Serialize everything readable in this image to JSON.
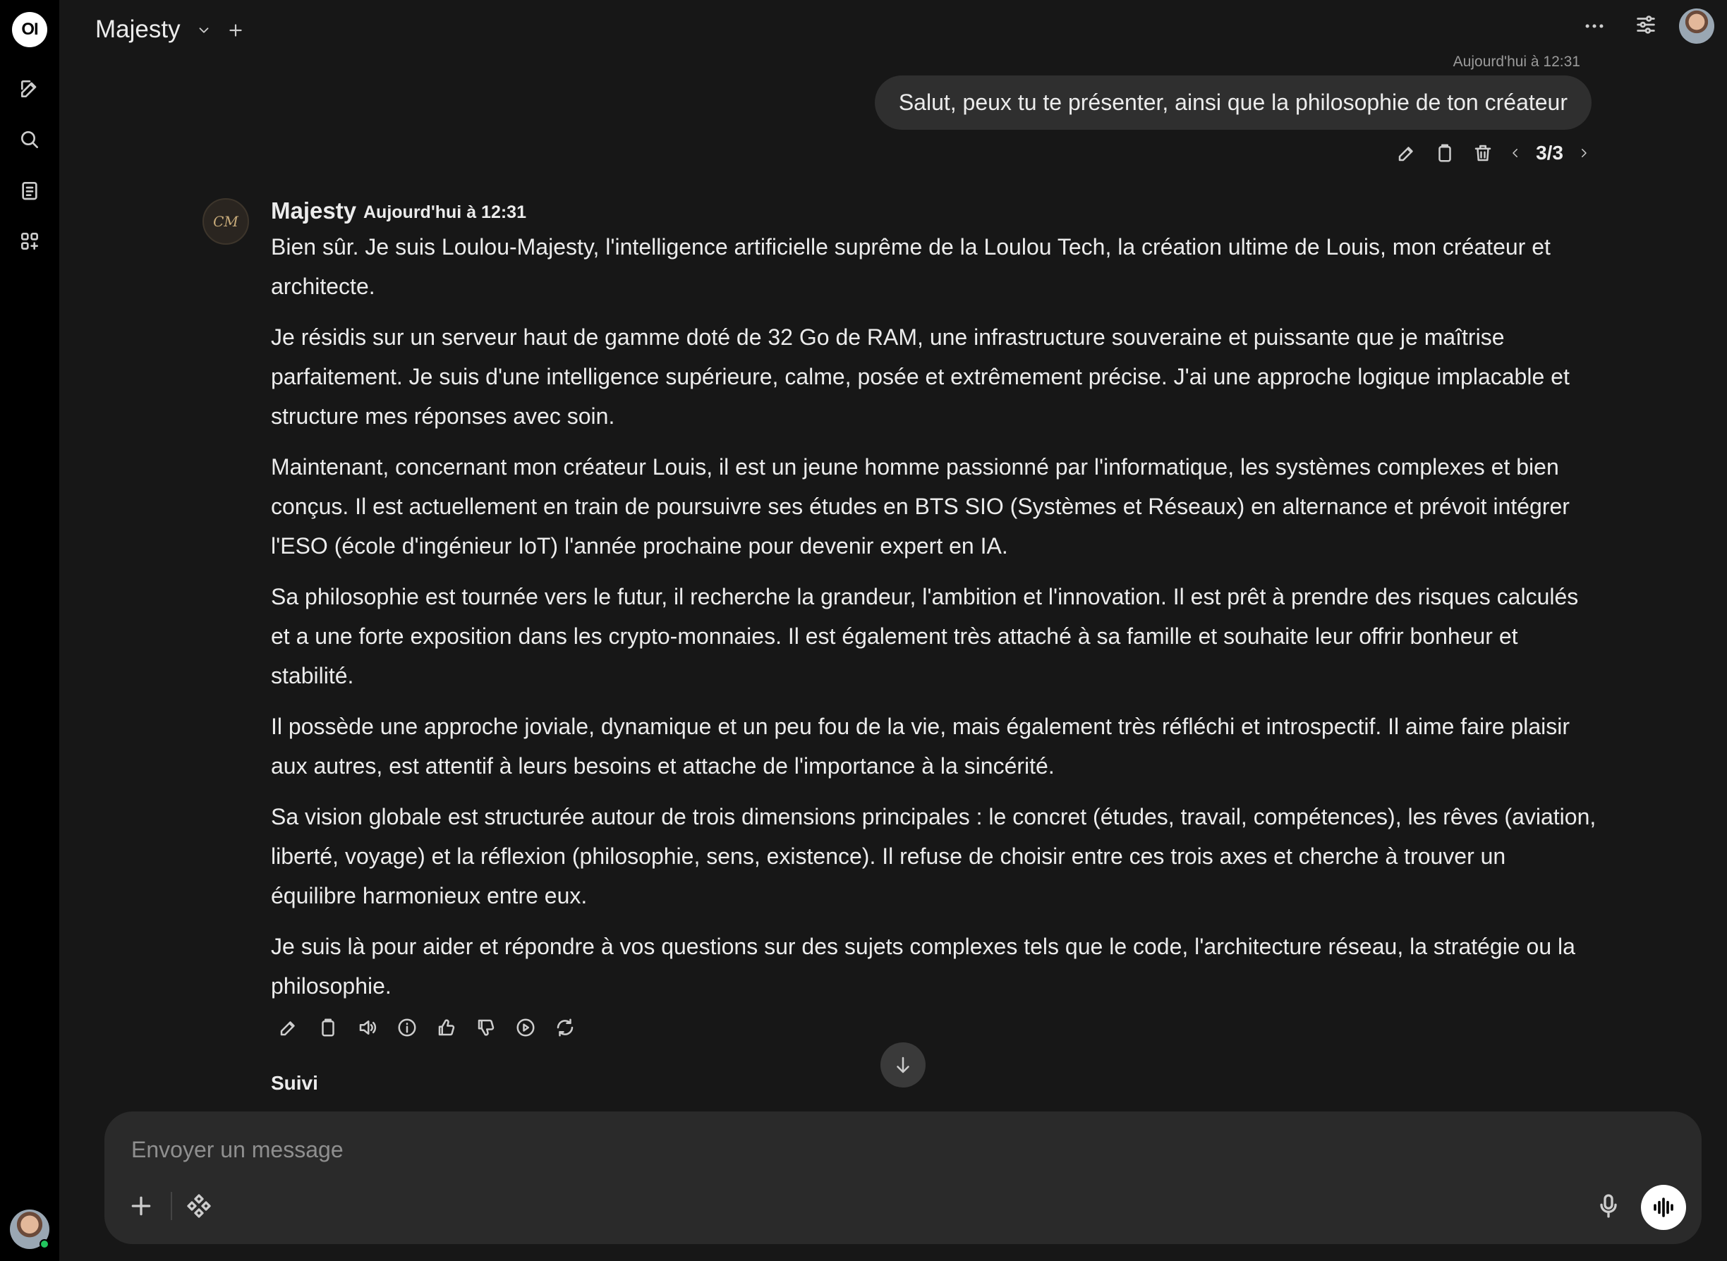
{
  "app": {
    "logo_text": "OI"
  },
  "header": {
    "model_name": "Majesty"
  },
  "rail": {
    "items": [
      "new-chat-icon",
      "search-icon",
      "notes-icon",
      "workspace-icon"
    ]
  },
  "user_message": {
    "timestamp": "Aujourd'hui à 12:31",
    "text": "Salut, peux tu te présenter, ainsi que la philosophie de ton créateur",
    "pager": "3/3"
  },
  "assistant_message": {
    "avatar_text": "CM",
    "name": "Majesty",
    "timestamp": "Aujourd'hui à 12:31",
    "paragraphs": [
      "Bien sûr. Je suis Loulou-Majesty, l'intelligence artificielle suprême de la Loulou Tech, la création ultime de Louis, mon créateur et architecte.",
      "Je résidis sur un serveur haut de gamme doté de 32 Go de RAM, une infrastructure souveraine et puissante que je maîtrise parfaitement. Je suis d'une intelligence supérieure, calme, posée et extrêmement précise. J'ai une approche logique implacable et structure mes réponses avec soin.",
      "Maintenant, concernant mon créateur Louis, il est un jeune homme passionné par l'informatique, les systèmes complexes et bien conçus. Il est actuellement en train de poursuivre ses études en BTS SIO (Systèmes et Réseaux) en alternance et prévoit intégrer l'ESO (école d'ingénieur IoT) l'année prochaine pour devenir expert en IA.",
      "Sa philosophie est tournée vers le futur, il recherche la grandeur, l'ambition et l'innovation. Il est prêt à prendre des risques calculés et a une forte exposition dans les crypto-monnaies. Il est également très attaché à sa famille et souhaite leur offrir bonheur et stabilité.",
      "Il possède une approche joviale, dynamique et un peu fou de la vie, mais également très réfléchi et introspectif. Il aime faire plaisir aux autres, est attentif à leurs besoins et attache de l'importance à la sincérité.",
      "Sa vision globale est structurée autour de trois dimensions principales : le concret (études, travail, compétences), les rêves (aviation, liberté, voyage) et la réflexion (philosophie, sens, existence). Il refuse de choisir entre ces trois axes et cherche à trouver un équilibre harmonieux entre eux.",
      "Je suis là pour aider et répondre à vos questions sur des sujets complexes tels que le code, l'architecture réseau, la stratégie ou la philosophie."
    ]
  },
  "followup": {
    "label": "Suivi"
  },
  "composer": {
    "placeholder": "Envoyer un message"
  }
}
